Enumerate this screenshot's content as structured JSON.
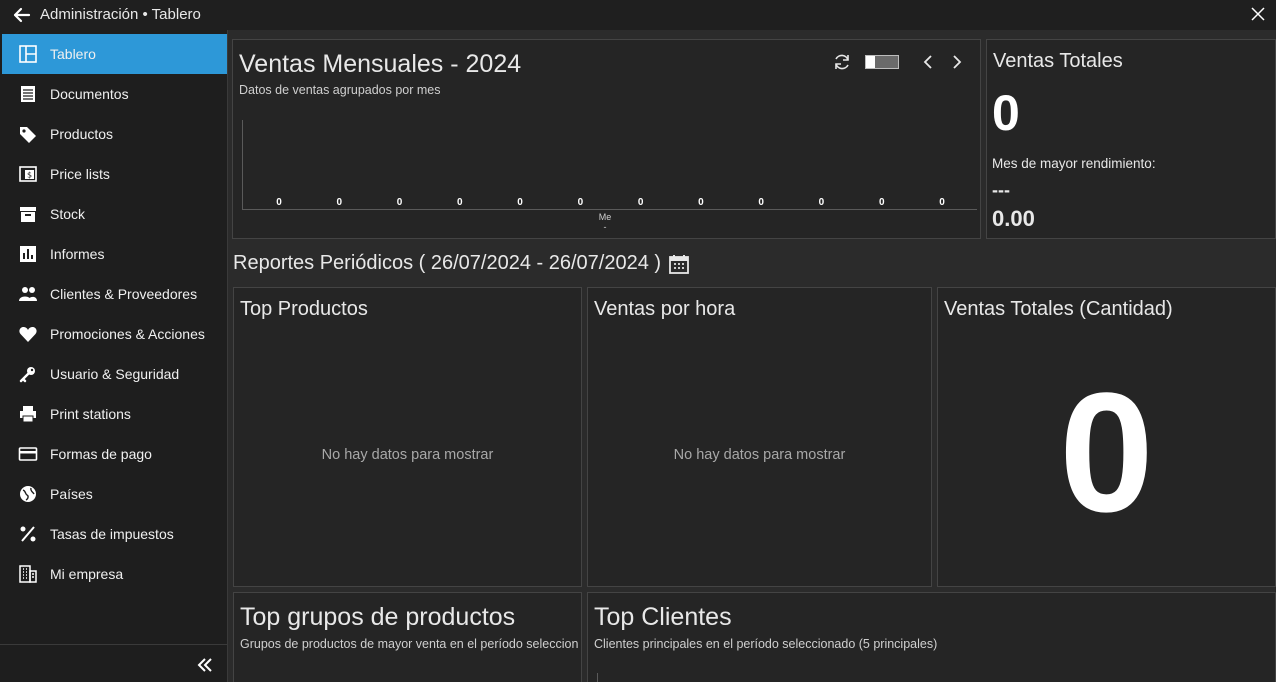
{
  "window": {
    "title": "Administración • Tablero",
    "back_icon": "arrow-left-icon",
    "close_icon": "close-icon"
  },
  "sidebar": {
    "items": [
      {
        "label": "Tablero",
        "icon": "dashboard-icon",
        "active": true
      },
      {
        "label": "Documentos",
        "icon": "document-icon"
      },
      {
        "label": "Productos",
        "icon": "tag-icon"
      },
      {
        "label": "Price lists",
        "icon": "price-list-icon"
      },
      {
        "label": "Stock",
        "icon": "archive-box-icon"
      },
      {
        "label": "Informes",
        "icon": "bar-chart-icon"
      },
      {
        "label": "Clientes & Proveedores",
        "icon": "people-icon"
      },
      {
        "label": "Promociones & Acciones",
        "icon": "heart-icon"
      },
      {
        "label": "Usuario & Seguridad",
        "icon": "key-icon"
      },
      {
        "label": "Print stations",
        "icon": "printer-icon"
      },
      {
        "label": "Formas de pago",
        "icon": "credit-card-icon"
      },
      {
        "label": "Países",
        "icon": "globe-icon"
      },
      {
        "label": "Tasas de impuestos",
        "icon": "percent-icon"
      },
      {
        "label": "Mi empresa",
        "icon": "building-icon"
      }
    ],
    "collapse_icon": "double-chevron-left-icon"
  },
  "monthly_sales": {
    "title": "Ventas Mensuales - 2024",
    "subtitle": "Datos de ventas agrupados por mes",
    "refresh_icon": "refresh-icon",
    "prev_icon": "chevron-left-icon",
    "next_icon": "chevron-right-icon"
  },
  "chart_data": {
    "type": "bar",
    "categories": [
      "",
      "",
      "",
      "",
      "",
      "",
      "",
      "",
      "",
      "",
      "",
      ""
    ],
    "values": [
      0,
      0,
      0,
      0,
      0,
      0,
      0,
      0,
      0,
      0,
      0,
      0
    ],
    "data_labels": [
      "0",
      "0",
      "0",
      "0",
      "0",
      "0",
      "0",
      "0",
      "0",
      "0",
      "0",
      "0"
    ],
    "xlabel": "Me",
    "xtick": "-",
    "grid": false
  },
  "total_sales": {
    "title": "Ventas Totales",
    "value": "0",
    "best_label": "Mes de mayor rendimiento:",
    "best_month": "---",
    "best_value": "0.00"
  },
  "reports": {
    "heading": "Reportes Periódicos ( 26/07/2024 - 26/07/2024 )",
    "calendar_icon": "calendar-icon"
  },
  "top_products": {
    "title": "Top Productos",
    "empty": "No hay datos para mostrar"
  },
  "sales_by_hour": {
    "title": "Ventas por hora",
    "empty": "No hay datos para mostrar"
  },
  "total_quantity": {
    "title": "Ventas Totales (Cantidad)",
    "value": "0"
  },
  "top_groups": {
    "title": "Top grupos de productos",
    "subtitle": "Grupos de productos de mayor venta en el período seleccionado"
  },
  "top_clients": {
    "title": "Top Clientes",
    "subtitle": "Clientes principales en el período seleccionado (5 principales)"
  }
}
